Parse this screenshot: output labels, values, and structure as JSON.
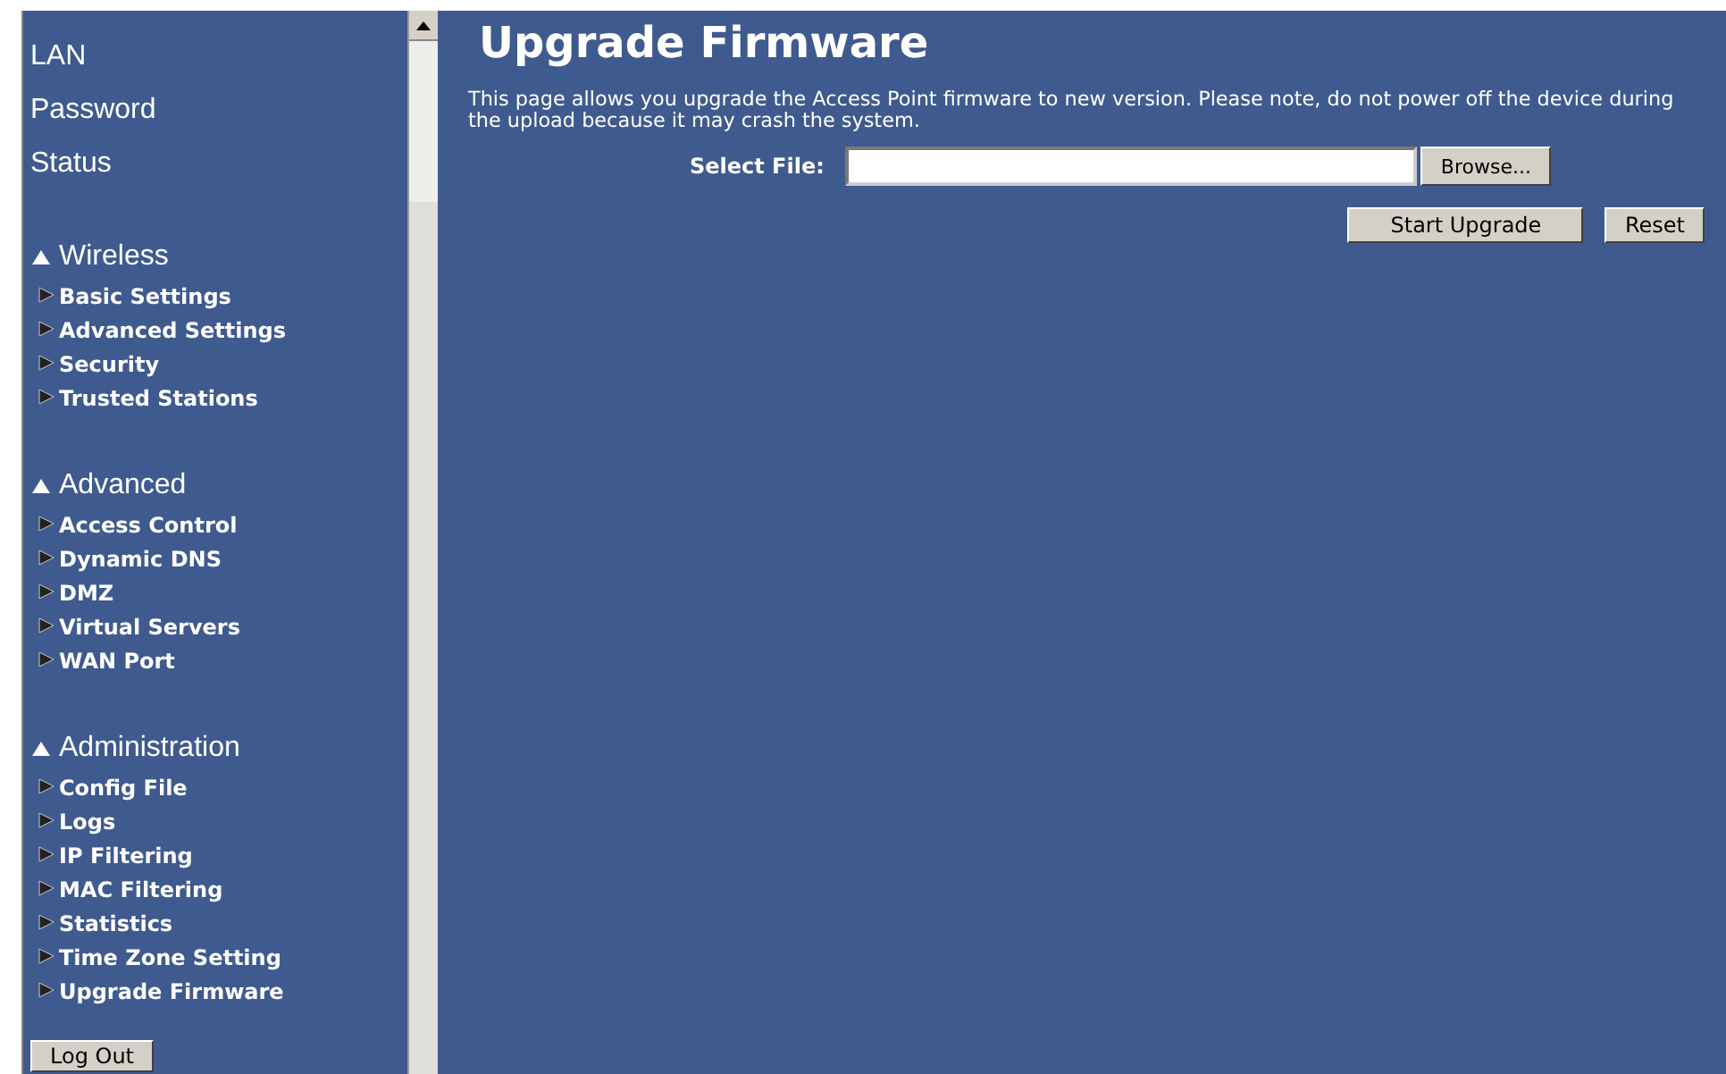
{
  "sidebar": {
    "links": [
      "LAN",
      "Password",
      "Status"
    ],
    "sections": [
      {
        "title": "Wireless",
        "items": [
          "Basic Settings",
          "Advanced Settings",
          "Security",
          "Trusted Stations"
        ]
      },
      {
        "title": "Advanced",
        "items": [
          "Access Control",
          "Dynamic DNS",
          "DMZ",
          "Virtual Servers",
          "WAN Port"
        ]
      },
      {
        "title": "Administration",
        "items": [
          "Config File",
          "Logs",
          "IP Filtering",
          "MAC Filtering",
          "Statistics",
          "Time Zone Setting",
          "Upgrade Firmware"
        ]
      }
    ],
    "logout": "Log Out"
  },
  "main": {
    "title": "Upgrade Firmware",
    "description": "This page allows you upgrade the Access Point firmware to new version. Please note, do not power off the device during the upload because it may crash the system.",
    "file_label": "Select File:",
    "browse": "Browse...",
    "buttons": [
      "Start Upgrade",
      "Reset"
    ]
  }
}
